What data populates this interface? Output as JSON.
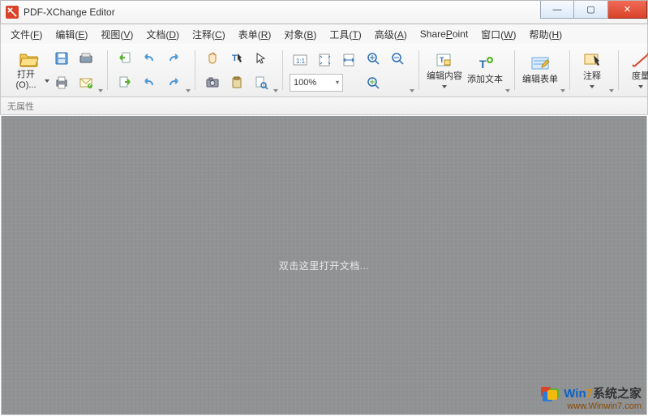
{
  "app": {
    "title": "PDF-XChange Editor"
  },
  "window_controls": {
    "minimize": "—",
    "maximize": "▢",
    "close": "✕"
  },
  "menu": [
    {
      "label": "文件",
      "key": "F"
    },
    {
      "label": "编辑",
      "key": "E"
    },
    {
      "label": "视图",
      "key": "V"
    },
    {
      "label": "文档",
      "key": "D"
    },
    {
      "label": "注释",
      "key": "C"
    },
    {
      "label": "表单",
      "key": "R"
    },
    {
      "label": "对象",
      "key": "B"
    },
    {
      "label": "工具",
      "key": "T"
    },
    {
      "label": "高级",
      "key": "A"
    },
    {
      "label": "SharePoint",
      "key": ""
    },
    {
      "label": "窗口",
      "key": "W"
    },
    {
      "label": "帮助",
      "key": "H"
    }
  ],
  "toolbar": {
    "open": "打开(O)...",
    "zoom_value": "100%",
    "edit_content": "编辑内容",
    "add_text": "添加文本",
    "edit_form": "编辑表单",
    "comment": "注释",
    "measure": "度量"
  },
  "properties_bar": {
    "no_props": "无属性"
  },
  "canvas": {
    "hint": "双击这里打开文档..."
  },
  "watermark": {
    "line1a": "Win",
    "line1b": "7",
    "line1c": "系统之家",
    "line2": "www.Winwin7.com"
  }
}
